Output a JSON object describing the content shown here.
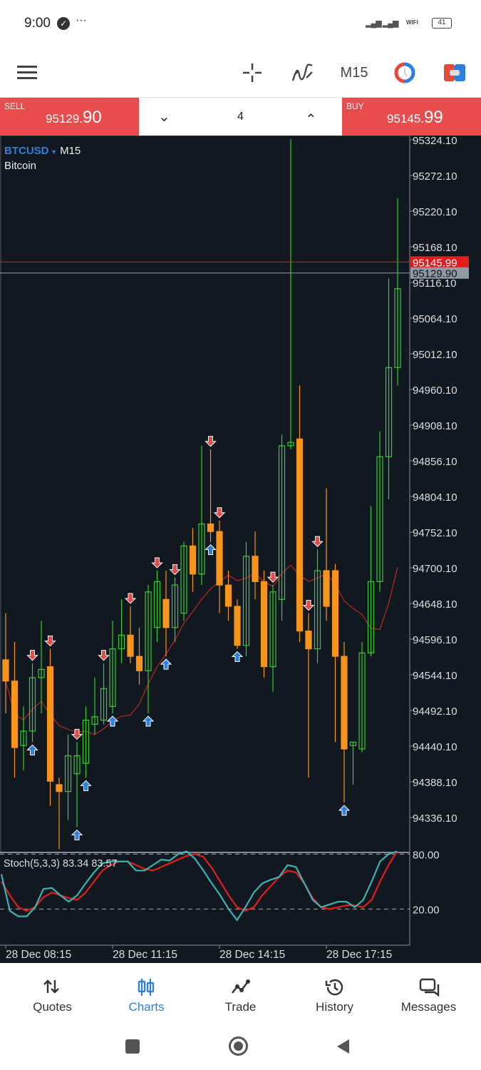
{
  "status_bar": {
    "time": "9:00",
    "battery": "41",
    "network": "WIFI"
  },
  "toolbar": {
    "timeframe": "M15",
    "icons": [
      "menu-icon",
      "crosshair-icon",
      "indicators-icon",
      "timeframe-label",
      "clock-icon",
      "trade-icon"
    ]
  },
  "trade_panel": {
    "sell_label": "SELL",
    "sell_price_main": "95129.",
    "sell_price_big": "90",
    "buy_label": "BUY",
    "buy_price_main": "95145.",
    "buy_price_big": "99",
    "volume": "4"
  },
  "chart": {
    "symbol": "BTCUSD",
    "timeframe": "M15",
    "description": "Bitcoin",
    "ask": "95145.99",
    "bid": "95129.90",
    "colors": {
      "bull": "#33cc33",
      "bear": "#f7941d",
      "ask_line": "#e11d1d",
      "bid_line": "#8f9aa5",
      "ma": "#d42a2a",
      "background": "#111820"
    }
  },
  "chart_data": {
    "type": "candlestick",
    "price_ticks": [
      "95324.10",
      "95272.10",
      "95220.10",
      "95168.10",
      "95116.10",
      "95064.10",
      "95012.10",
      "94960.10",
      "94908.10",
      "94856.10",
      "94804.10",
      "94752.10",
      "94700.10",
      "94648.10",
      "94596.10",
      "94544.10",
      "94492.10",
      "94440.10",
      "94388.10",
      "94336.10"
    ],
    "ylim": [
      94336.1,
      95324.1
    ],
    "time_labels": [
      "28 Dec 08:15",
      "28 Dec 11:15",
      "28 Dec 14:15",
      "28 Dec 17:15"
    ],
    "candles": [
      [
        94566,
        94535,
        94634,
        94488
      ],
      [
        94535,
        94438,
        94592,
        94394
      ],
      [
        94441,
        94462,
        94498,
        94405
      ],
      [
        94462,
        94540,
        94561,
        94446
      ],
      [
        94540,
        94552,
        94623,
        94488
      ],
      [
        94556,
        94389,
        94582,
        94353
      ],
      [
        94384,
        94374,
        94394,
        94290
      ],
      [
        94374,
        94426,
        94457,
        94332
      ],
      [
        94400,
        94426,
        94446,
        94322
      ],
      [
        94415,
        94478,
        94498,
        94394
      ],
      [
        94472,
        94483,
        94540,
        94457
      ],
      [
        94478,
        94524,
        94561,
        94472
      ],
      [
        94498,
        94582,
        94623,
        94488
      ],
      [
        94582,
        94602,
        94654,
        94561
      ],
      [
        94602,
        94571,
        94644,
        94561
      ],
      [
        94571,
        94550,
        94613,
        94530
      ],
      [
        94550,
        94665,
        94675,
        94488
      ],
      [
        94613,
        94680,
        94696,
        94592
      ],
      [
        94654,
        94613,
        94696,
        94571
      ],
      [
        94613,
        94675,
        94686,
        94592
      ],
      [
        94634,
        94732,
        94738,
        94623
      ],
      [
        94732,
        94691,
        94758,
        94665
      ],
      [
        94691,
        94764,
        94878,
        94675
      ],
      [
        94764,
        94753,
        94873,
        94738
      ],
      [
        94753,
        94675,
        94769,
        94634
      ],
      [
        94675,
        94644,
        94696,
        94623
      ],
      [
        94644,
        94587,
        94654,
        94582
      ],
      [
        94587,
        94717,
        94738,
        94571
      ],
      [
        94717,
        94680,
        94753,
        94654
      ],
      [
        94680,
        94556,
        94696,
        94540
      ],
      [
        94556,
        94665,
        94675,
        94519
      ],
      [
        94654,
        94878,
        94894,
        94623
      ],
      [
        94878,
        94883,
        95325,
        94873
      ],
      [
        94888,
        94608,
        94966,
        94592
      ],
      [
        94608,
        94582,
        94634,
        94394
      ],
      [
        94582,
        94696,
        94727,
        94561
      ],
      [
        94696,
        94644,
        94816,
        94623
      ],
      [
        94696,
        94571,
        94706,
        94446
      ],
      [
        94571,
        94436,
        94592,
        94358
      ],
      [
        94441,
        94446,
        94446,
        94384
      ],
      [
        94436,
        94576,
        94592,
        94431
      ],
      [
        94576,
        94680,
        94790,
        94571
      ],
      [
        94680,
        94862,
        94899,
        94665
      ],
      [
        94862,
        94992,
        95122,
        94800
      ],
      [
        94992,
        95107,
        95239,
        94966
      ]
    ],
    "signals": [
      {
        "i": 3,
        "dir": "up"
      },
      {
        "i": 3,
        "dir": "down"
      },
      {
        "i": 5,
        "dir": "down"
      },
      {
        "i": 8,
        "dir": "up"
      },
      {
        "i": 8,
        "dir": "down"
      },
      {
        "i": 9,
        "dir": "up"
      },
      {
        "i": 11,
        "dir": "down"
      },
      {
        "i": 12,
        "dir": "up"
      },
      {
        "i": 14,
        "dir": "down"
      },
      {
        "i": 16,
        "dir": "up"
      },
      {
        "i": 17,
        "dir": "down"
      },
      {
        "i": 18,
        "dir": "up"
      },
      {
        "i": 19,
        "dir": "down"
      },
      {
        "i": 23,
        "dir": "down"
      },
      {
        "i": 23,
        "dir": "up"
      },
      {
        "i": 24,
        "dir": "down"
      },
      {
        "i": 26,
        "dir": "up"
      },
      {
        "i": 30,
        "dir": "down"
      },
      {
        "i": 34,
        "dir": "down"
      },
      {
        "i": 35,
        "dir": "down"
      },
      {
        "i": 38,
        "dir": "up"
      }
    ],
    "stochastic": {
      "label": "Stoch(5,3,3) 83.34 83.57",
      "levels": [
        "80.00",
        "20.00"
      ],
      "ylim": [
        0,
        100
      ],
      "main": [
        58,
        18,
        12,
        12,
        22,
        42,
        43,
        35,
        28,
        35,
        48,
        60,
        70,
        72,
        72,
        72,
        62,
        62,
        68,
        74,
        73,
        80,
        83,
        75,
        62,
        48,
        35,
        20,
        8,
        22,
        38,
        48,
        52,
        55,
        68,
        66,
        48,
        30,
        22,
        25,
        28,
        28,
        22,
        30,
        50,
        72,
        80,
        83
      ],
      "signal": [
        50,
        35,
        22,
        18,
        22,
        33,
        38,
        35,
        32,
        30,
        38,
        50,
        62,
        68,
        72,
        72,
        68,
        64,
        62,
        66,
        70,
        74,
        78,
        80,
        77,
        65,
        50,
        35,
        22,
        18,
        22,
        35,
        45,
        55,
        62,
        60,
        48,
        32,
        22,
        20,
        22,
        24,
        24,
        22,
        30,
        50,
        68,
        83
      ],
      "colors": {
        "main": "#3bb3b0",
        "signal": "#e01e1e"
      }
    }
  },
  "bottom_nav": [
    {
      "label": "Quotes",
      "icon": "arrows-updown-icon"
    },
    {
      "label": "Charts",
      "icon": "candles-icon",
      "active": true
    },
    {
      "label": "Trade",
      "icon": "trend-icon"
    },
    {
      "label": "History",
      "icon": "history-icon"
    },
    {
      "label": "Messages",
      "icon": "messages-icon"
    }
  ]
}
